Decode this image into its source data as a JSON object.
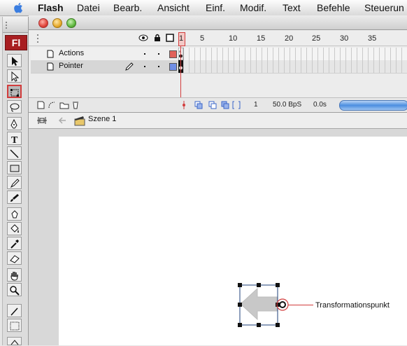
{
  "menubar": {
    "app": "Flash",
    "items": [
      "Datei",
      "Bearb.",
      "Ansicht",
      "Einf.",
      "Modif.",
      "Text",
      "Befehle",
      "Steuerun"
    ]
  },
  "tools": {
    "logo": "Fl",
    "active_tool": "free-transform"
  },
  "timeline": {
    "frame_numbers": [
      "1",
      "5",
      "10",
      "15",
      "20",
      "25",
      "30",
      "35"
    ],
    "layers": [
      {
        "name": "Actions",
        "color": "#e0625a",
        "selected": false
      },
      {
        "name": "Pointer",
        "color": "#6f8fe6",
        "selected": true
      }
    ],
    "footer": {
      "current_frame": "1",
      "frame_rate": "50.0 BpS",
      "elapsed": "0.0s"
    }
  },
  "editbar": {
    "scene": "Szene 1"
  },
  "stage": {
    "callout_label": "Transformationspunkt"
  },
  "colors": {
    "accent_red": "#d23c3c",
    "stage": "#ffffff",
    "pasteboard": "#d8d8d8"
  }
}
